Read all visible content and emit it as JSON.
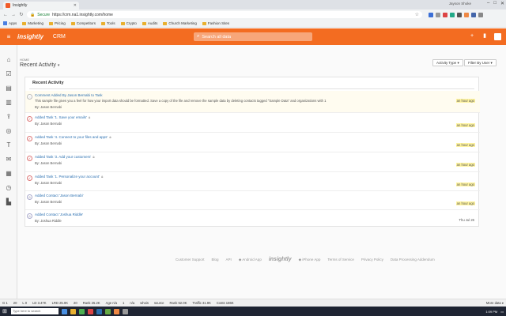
{
  "browser": {
    "tab_title": "Insightly",
    "window_user": "Jayson Shoke",
    "secure_label": "Secure",
    "url": "https://crm.na1.insightly.com/home",
    "bookmarks": [
      "Apps",
      "Marketing",
      "Pricing",
      "Competitors",
      "Tools",
      "Crypto",
      "Audits",
      "Church Marketing",
      "Fashion Sites"
    ]
  },
  "app": {
    "logo": "insightly",
    "module": "CRM",
    "search_placeholder": "Search all data",
    "accent": "#f36c21"
  },
  "page": {
    "breadcrumb": "Home",
    "title": "Recent Activity",
    "filter_activity": "Activity Type",
    "filter_user": "Filter By User"
  },
  "card": {
    "title": "Recent Activity",
    "activities": [
      {
        "type": "comment",
        "head": "Comment Added By Jason Bernabi to Task",
        "desc": "This sample file gives you a feel for how your import data should be formatted. Save a copy of the file and remove the sample data by deleting contacts tagged \"Sample Data\" and organizations with 1",
        "by": "By: Jason Bernabi",
        "when": "an hour ago"
      },
      {
        "type": "task",
        "head": "Added Task '1. Save your emails'",
        "by": "By: Jason Bernabi",
        "when": "an hour ago"
      },
      {
        "type": "task",
        "head": "Added Task '4. Connect to your files and apps'",
        "by": "By: Jason Bernabi",
        "when": "an hour ago"
      },
      {
        "type": "task",
        "head": "Added Task '3. Add your customers'",
        "by": "By: Jason Bernabi",
        "when": "an hour ago"
      },
      {
        "type": "task",
        "head": "Added Task '1. Personalize your account'",
        "by": "By: Jason Bernabi",
        "when": "an hour ago"
      },
      {
        "type": "contact",
        "head": "Added Contact 'Jason Bernabi'",
        "by": "By: Jason Bernabi",
        "when": "an hour ago"
      },
      {
        "type": "contact",
        "head": "Added Contact 'Joshua Riddle'",
        "by": "By: Joshua Riddle",
        "when": "Thu Jul 26"
      }
    ]
  },
  "footer": {
    "links": [
      "Customer Support",
      "Blog",
      "API",
      "Android App",
      "iPhone App",
      "Terms of Service",
      "Privacy Policy",
      "Data Processing Addendum"
    ],
    "logo": "insightly"
  },
  "ext_toolbar": {
    "items": [
      "G 1",
      "20",
      "L 0",
      "LD 3.47K",
      "LRD 25.0K",
      "20",
      "Rank 25.2K",
      "Age n/a",
      "1",
      "n/a",
      "whois",
      "source",
      "Rank 52.0K",
      "Traffic 31.9K",
      "Costs 186K"
    ],
    "more": "More data"
  },
  "taskbar": {
    "search": "Type here to search",
    "time": "1:09 PM"
  }
}
